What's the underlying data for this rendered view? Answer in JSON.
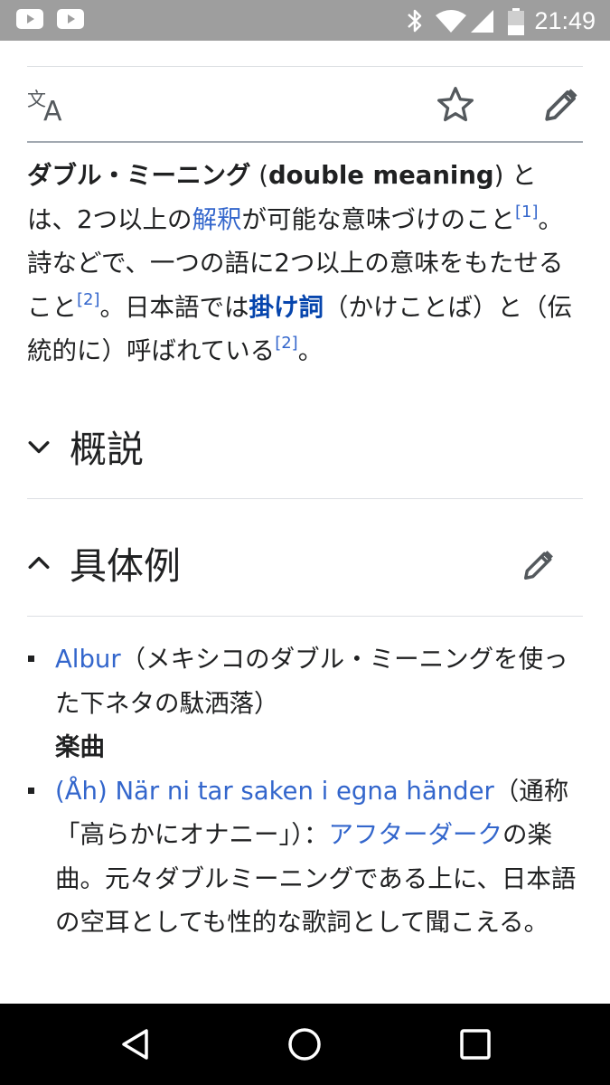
{
  "status_bar": {
    "time": "21:49",
    "icons": [
      "youtube-icon",
      "youtube-icon",
      "bluetooth-icon",
      "wifi-icon",
      "signal-icon",
      "battery-icon"
    ],
    "bg_color": "#9e9e9e"
  },
  "toolbar": {
    "icons": [
      "translate-icon",
      "star-icon",
      "pencil-icon"
    ]
  },
  "article": {
    "lead_bold": "ダブル・ミーニング",
    "lead_bold_en": "double meaning",
    "paren_open": " (",
    "paren_close": ") とは、2つ以上の",
    "link_kaishaku": "解釈",
    "text2": "が可能な意味づけのこと",
    "ref1": "[1]",
    "text3": "。詩などで、一つの語に2つ以上の意味をもたせること",
    "ref2": "[2]",
    "text4": "。日本語では",
    "link_kakekotoba": "掛け詞",
    "text5": "（かけことば）と（伝統的に）呼ばれている",
    "ref3": "[2]",
    "text6": "。"
  },
  "sections": [
    {
      "title": "概説",
      "expanded": false
    },
    {
      "title": "具体例",
      "expanded": true
    }
  ],
  "list": {
    "item1_link": "Albur",
    "item1_text": "（メキシコのダブル・ミーニングを使った下ネタの駄洒落）",
    "subheading": "楽曲",
    "item2_link": "(Åh) När ni tar saken i egna händer",
    "item2_text1": "（通称「高らかにオナニー」）：",
    "item2_link2": "アフターダーク",
    "item2_text2": "の楽曲。元々ダブルミーニングである上に、日本語の空耳としても性的な歌詞として聞こえる。"
  },
  "nav_bar": {
    "buttons": [
      "back-button",
      "home-button",
      "recents-button"
    ]
  },
  "colors": {
    "link": "#3366cc",
    "text": "#202122",
    "icon": "#54595d"
  }
}
